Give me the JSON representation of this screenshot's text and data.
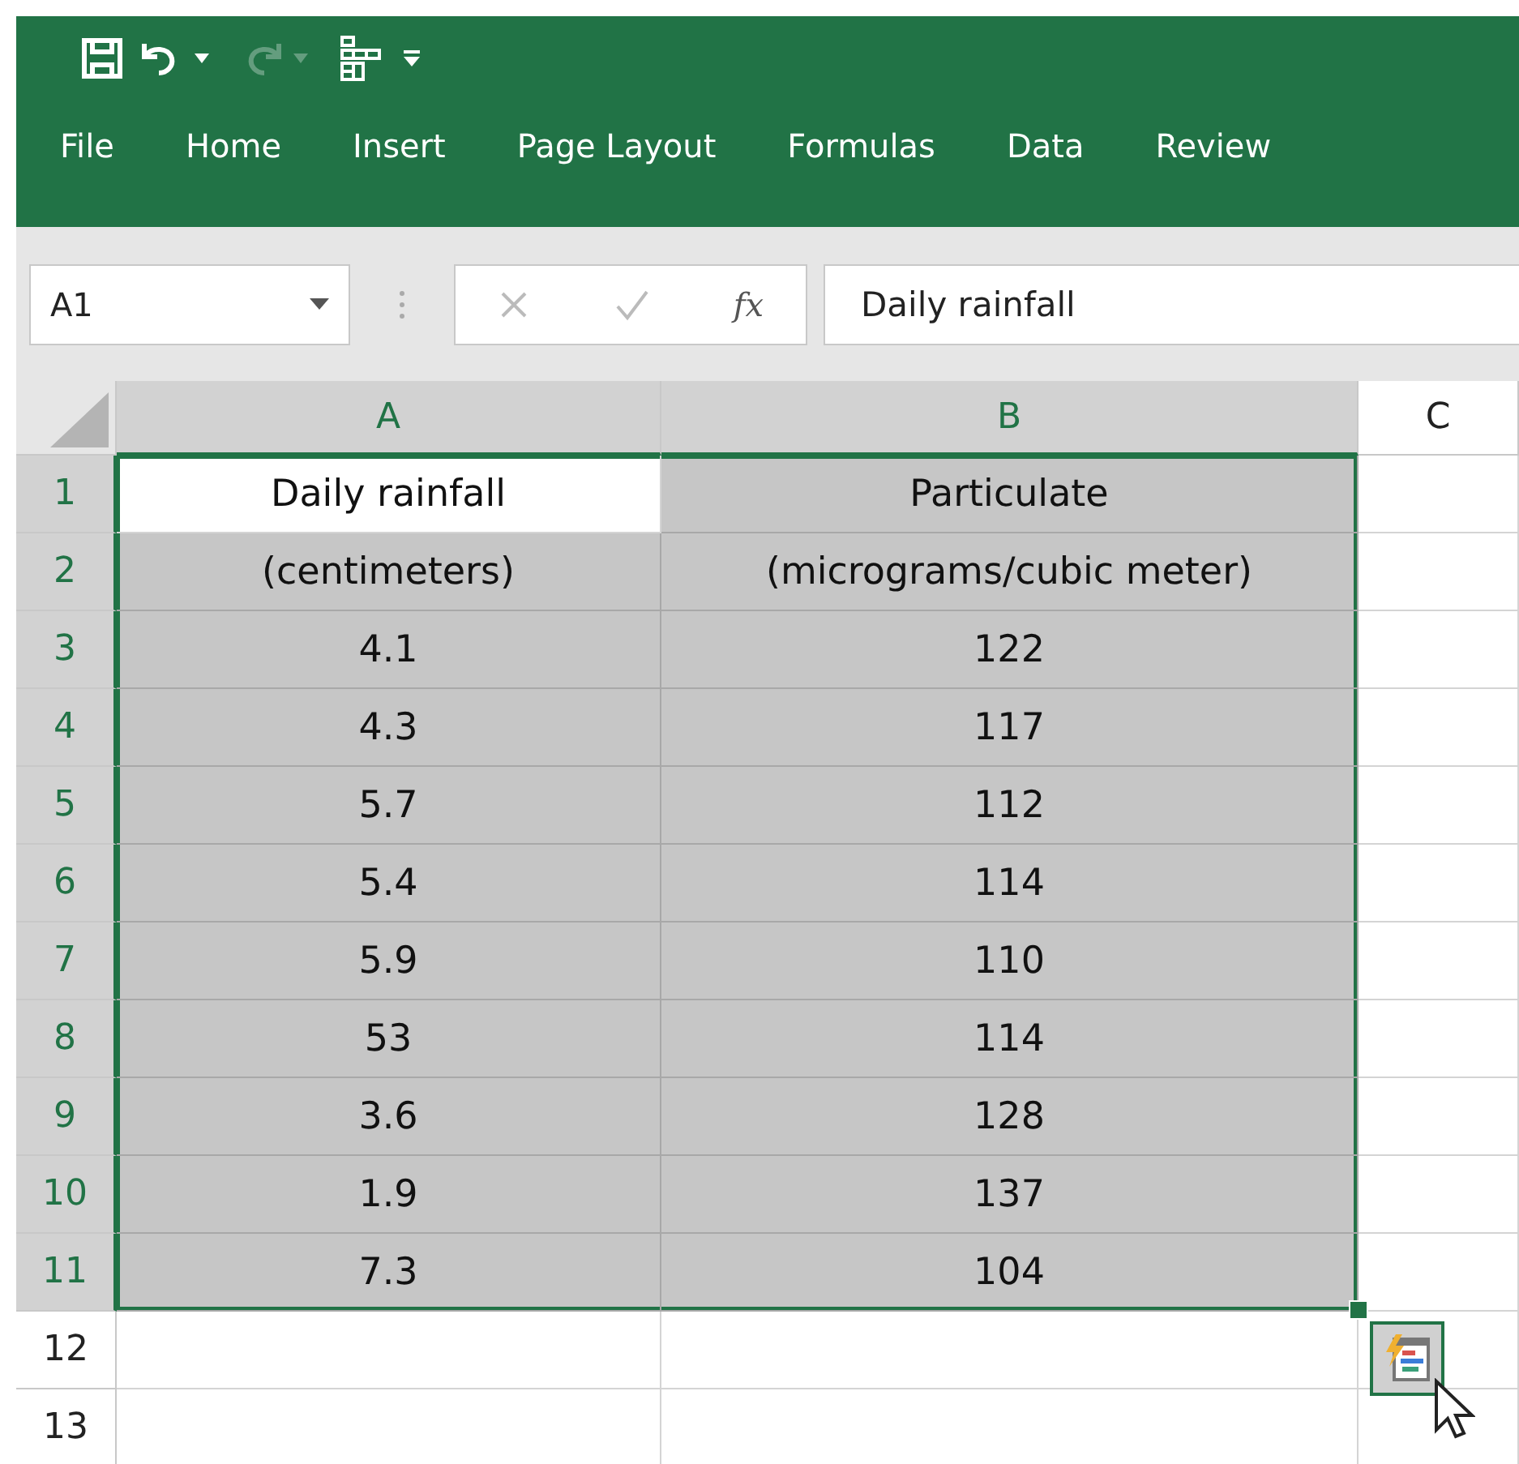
{
  "quick_access": {
    "redo_disabled": true
  },
  "ribbon": {
    "tabs": [
      {
        "label": "File"
      },
      {
        "label": "Home"
      },
      {
        "label": "Insert"
      },
      {
        "label": "Page Layout"
      },
      {
        "label": "Formulas"
      },
      {
        "label": "Data"
      },
      {
        "label": "Review"
      }
    ]
  },
  "formula_bar": {
    "name_box": "A1",
    "function_label": "fx",
    "value": "Daily rainfall"
  },
  "sheet": {
    "columns": [
      {
        "label": "A",
        "selected": true
      },
      {
        "label": "B",
        "selected": true
      },
      {
        "label": "C",
        "selected": false
      }
    ],
    "rows": [
      {
        "label": "1",
        "selected": true,
        "cells": [
          {
            "text": "Daily rainfall",
            "selected": true,
            "active": true
          },
          {
            "text": "Particulate",
            "selected": true,
            "active": false
          }
        ]
      },
      {
        "label": "2",
        "selected": true,
        "cells": [
          {
            "text": "(centimeters)",
            "selected": true,
            "active": false
          },
          {
            "text": "(micrograms/cubic meter)",
            "selected": true,
            "active": false
          }
        ]
      },
      {
        "label": "3",
        "selected": true,
        "cells": [
          {
            "text": "4.1",
            "selected": true,
            "active": false
          },
          {
            "text": "122",
            "selected": true,
            "active": false
          }
        ]
      },
      {
        "label": "4",
        "selected": true,
        "cells": [
          {
            "text": "4.3",
            "selected": true,
            "active": false
          },
          {
            "text": "117",
            "selected": true,
            "active": false
          }
        ]
      },
      {
        "label": "5",
        "selected": true,
        "cells": [
          {
            "text": "5.7",
            "selected": true,
            "active": false
          },
          {
            "text": "112",
            "selected": true,
            "active": false
          }
        ]
      },
      {
        "label": "6",
        "selected": true,
        "cells": [
          {
            "text": "5.4",
            "selected": true,
            "active": false
          },
          {
            "text": "114",
            "selected": true,
            "active": false
          }
        ]
      },
      {
        "label": "7",
        "selected": true,
        "cells": [
          {
            "text": "5.9",
            "selected": true,
            "active": false
          },
          {
            "text": "110",
            "selected": true,
            "active": false
          }
        ]
      },
      {
        "label": "8",
        "selected": true,
        "cells": [
          {
            "text": "53",
            "selected": true,
            "active": false
          },
          {
            "text": "114",
            "selected": true,
            "active": false
          }
        ]
      },
      {
        "label": "9",
        "selected": true,
        "cells": [
          {
            "text": "3.6",
            "selected": true,
            "active": false
          },
          {
            "text": "128",
            "selected": true,
            "active": false
          }
        ]
      },
      {
        "label": "10",
        "selected": true,
        "cells": [
          {
            "text": "1.9",
            "selected": true,
            "active": false
          },
          {
            "text": "137",
            "selected": true,
            "active": false
          }
        ]
      },
      {
        "label": "11",
        "selected": true,
        "cells": [
          {
            "text": "7.3",
            "selected": true,
            "active": false
          },
          {
            "text": "104",
            "selected": true,
            "active": false
          }
        ]
      },
      {
        "label": "12",
        "selected": false,
        "cells": []
      },
      {
        "label": "13",
        "selected": false,
        "cells": []
      }
    ]
  }
}
